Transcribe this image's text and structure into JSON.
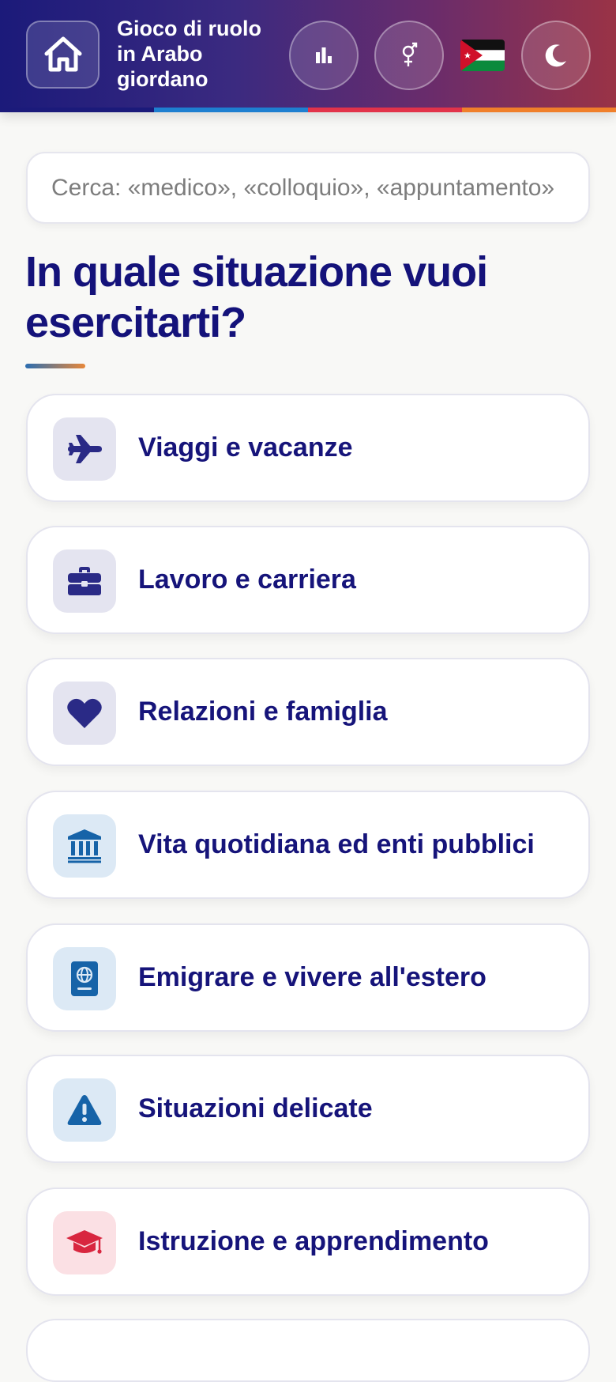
{
  "header": {
    "title": "Gioco di ruolo in Arabo giordano",
    "home_icon": "home-icon",
    "stats_icon": "bar-chart-icon",
    "gender_icon": "gender-icon",
    "flag_icon": "jordan-flag-icon",
    "theme_icon": "moon-icon",
    "stripe_colors": [
      "#1b1a7a",
      "#1e7fd0",
      "#e2334a",
      "#f07f2a"
    ]
  },
  "search": {
    "placeholder": "Cerca: «medico», «colloquio», «appuntamento»",
    "value": ""
  },
  "main": {
    "heading": "In quale situazione vuoi esercitarti?"
  },
  "categories": [
    {
      "label": "Viaggi e vacanze",
      "icon": "airplane-icon",
      "icon_bg": "#e4e4f0",
      "icon_color": "#2a2a86"
    },
    {
      "label": "Lavoro e carriera",
      "icon": "briefcase-icon",
      "icon_bg": "#e4e4f0",
      "icon_color": "#2a2a86"
    },
    {
      "label": "Relazioni e famiglia",
      "icon": "heart-icon",
      "icon_bg": "#e4e4f0",
      "icon_color": "#2a2a86"
    },
    {
      "label": "Vita quotidiana ed enti pubblici",
      "icon": "bank-icon",
      "icon_bg": "#dce9f5",
      "icon_color": "#1663a8"
    },
    {
      "label": "Emigrare e vivere all'estero",
      "icon": "passport-icon",
      "icon_bg": "#dce9f5",
      "icon_color": "#1663a8"
    },
    {
      "label": "Situazioni delicate",
      "icon": "warning-icon",
      "icon_bg": "#dce9f5",
      "icon_color": "#1663a8"
    },
    {
      "label": "Istruzione e apprendimento",
      "icon": "graduation-cap-icon",
      "icon_bg": "#fbe0e4",
      "icon_color": "#d8263f"
    }
  ]
}
